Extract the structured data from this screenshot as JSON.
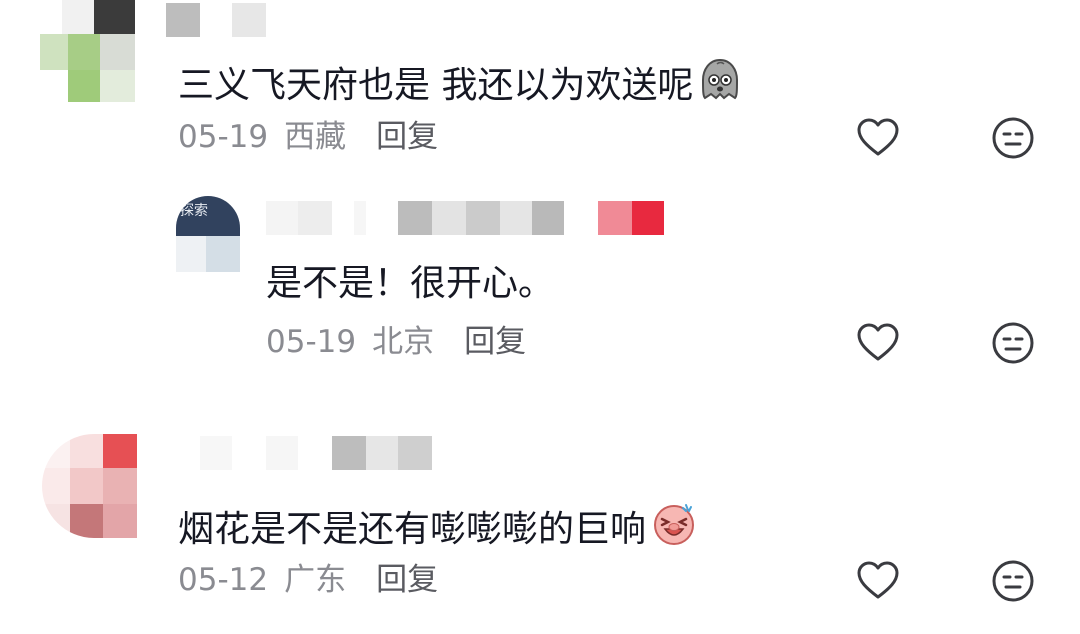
{
  "comments": [
    {
      "text": "三义飞天府也是 我还以为欢送呢",
      "date": "05-19",
      "location": "西藏",
      "reply_label": "回复",
      "emoji": "ghost-emoji"
    },
    {
      "avatar_badge": "探索",
      "text": "是不是！很开心。",
      "date": "05-19",
      "location": "北京",
      "reply_label": "回复"
    },
    {
      "text": "烟花是不是还有嘭嘭嘭的巨响",
      "date": "05-12",
      "location": "广东",
      "reply_label": "回复",
      "emoji": "laughing-pig-emoji"
    }
  ],
  "icons": {
    "like": "heart-outline-icon",
    "dislike": "neutral-face-icon"
  },
  "colors": {
    "text": "#161823",
    "meta": "#8a8b91",
    "reply": "#5a5b61",
    "icon": "#3a3b40"
  }
}
